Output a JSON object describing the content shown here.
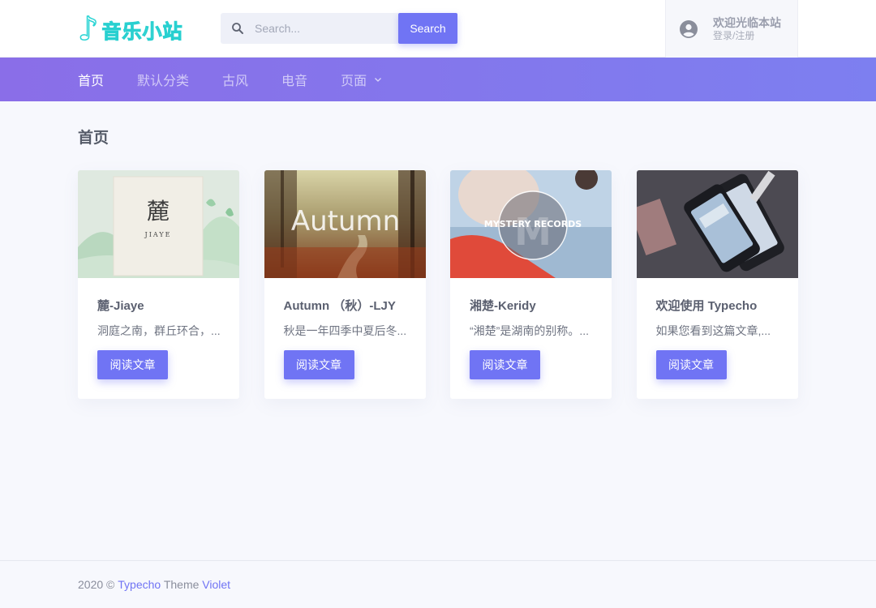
{
  "header": {
    "logo_icon": "music-note-icon",
    "logo_text": "音乐小站",
    "search_placeholder": "Search...",
    "search_button": "Search",
    "user_welcome": "欢迎光临本站",
    "user_login": "登录/注册"
  },
  "nav": {
    "items": [
      {
        "label": "首页",
        "active": true
      },
      {
        "label": "默认分类",
        "active": false
      },
      {
        "label": "古风",
        "active": false
      },
      {
        "label": "电音",
        "active": false
      },
      {
        "label": "页面",
        "active": false
      }
    ]
  },
  "page_title": "首页",
  "cards": [
    {
      "title": "麓-Jiaye",
      "excerpt": "洞庭之南，群丘环合，...",
      "button": "阅读文章",
      "thumb_title": "麓",
      "thumb_sub": "JIAYE"
    },
    {
      "title": "Autumn （秋）-LJY",
      "excerpt": "秋是一年四季中夏后冬...",
      "button": "阅读文章",
      "thumb_title": "Autumn"
    },
    {
      "title": "湘楚-Keridy",
      "excerpt": "“湘楚”是湖南的别称。...",
      "button": "阅读文章",
      "thumb_title": "MYSTERY RECORDS",
      "thumb_letter": "M"
    },
    {
      "title": "欢迎使用 Typecho",
      "excerpt": "如果您看到这篇文章,...",
      "button": "阅读文章"
    }
  ],
  "footer": {
    "year_prefix": "2020 © ",
    "typecho": "Typecho",
    "theme": " Theme ",
    "violet": "Violet"
  },
  "colors": {
    "accent": "#7074f4",
    "nav_gradient_start": "#8a6ee8",
    "nav_gradient_end": "#7d7ff0",
    "logo": "#2ad4d4"
  }
}
